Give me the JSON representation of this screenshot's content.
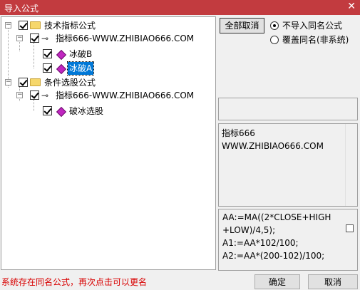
{
  "window": {
    "title": "导入公式",
    "close_label": "✕"
  },
  "tree": {
    "group1": {
      "label": "技术指标公式"
    },
    "group1_item": {
      "label": "指标666-WWW.ZHIBIAO666.COM"
    },
    "formula_b": {
      "label": "冰破B"
    },
    "formula_a": {
      "label": "冰破A"
    },
    "group2": {
      "label": "条件选股公式"
    },
    "group2_item": {
      "label": "指标666-WWW.ZHIBIAO666.COM"
    },
    "formula_c": {
      "label": "破冰选股"
    }
  },
  "controls": {
    "cancel_all_label": "全部取消",
    "option_no_import": "不导入同名公式",
    "option_overwrite": "覆盖同名(非系统)"
  },
  "info": {
    "line1": "指标666",
    "line2": "WWW.ZHIBIAO666.COM"
  },
  "formula_source": "AA:=MA((2*CLOSE+HIGH\n+LOW)/4,5);\nA1:=AA*102/100;\nA2:=AA*(200-102)/100;",
  "status_message": "系统存在同名公式，再次点击可以更名",
  "buttons": {
    "ok": "确定",
    "cancel": "取消"
  }
}
